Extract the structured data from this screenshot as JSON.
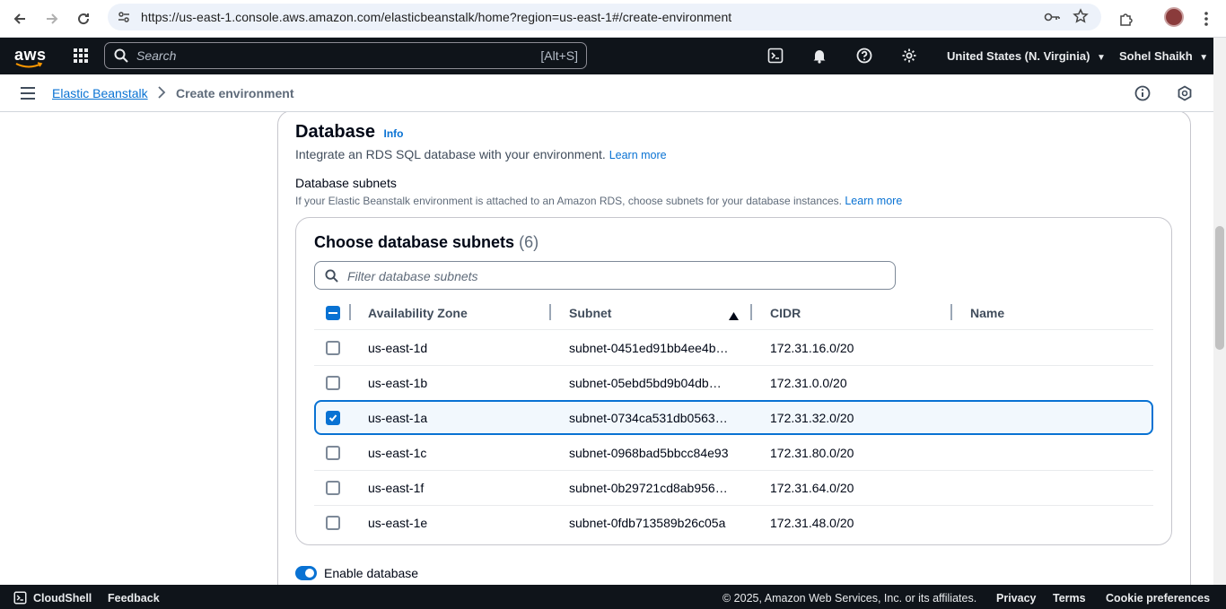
{
  "browser": {
    "url": "https://us-east-1.console.aws.amazon.com/elasticbeanstalk/home?region=us-east-1#/create-environment"
  },
  "topnav": {
    "logo": "aws",
    "search_placeholder": "Search",
    "search_shortcut": "[Alt+S]",
    "region": "United States (N. Virginia)",
    "user": "Sohel Shaikh"
  },
  "breadcrumb": {
    "parent": "Elastic Beanstalk",
    "current": "Create environment"
  },
  "database": {
    "title": "Database",
    "info": "Info",
    "description": "Integrate an RDS SQL database with your environment.",
    "learn_more": "Learn more",
    "subnets_label": "Database subnets",
    "subnets_desc": "If your Elastic Beanstalk environment is attached to an Amazon RDS, choose subnets for your database instances.",
    "subnets_learn_more": "Learn more",
    "table_title": "Choose database subnets",
    "table_count": "(6)",
    "filter_placeholder": "Filter database subnets",
    "columns": [
      "Availability Zone",
      "Subnet",
      "CIDR",
      "Name"
    ],
    "rows": [
      {
        "az": "us-east-1d",
        "subnet": "subnet-0451ed91bb4ee4b…",
        "cidr": "172.31.16.0/20",
        "name": "",
        "selected": false
      },
      {
        "az": "us-east-1b",
        "subnet": "subnet-05ebd5bd9b04db…",
        "cidr": "172.31.0.0/20",
        "name": "",
        "selected": false
      },
      {
        "az": "us-east-1a",
        "subnet": "subnet-0734ca531db0563…",
        "cidr": "172.31.32.0/20",
        "name": "",
        "selected": true
      },
      {
        "az": "us-east-1c",
        "subnet": "subnet-0968bad5bbcc84e93",
        "cidr": "172.31.80.0/20",
        "name": "",
        "selected": false
      },
      {
        "az": "us-east-1f",
        "subnet": "subnet-0b29721cd8ab956…",
        "cidr": "172.31.64.0/20",
        "name": "",
        "selected": false
      },
      {
        "az": "us-east-1e",
        "subnet": "subnet-0fdb713589b26c05a",
        "cidr": "172.31.48.0/20",
        "name": "",
        "selected": false
      }
    ],
    "enable_database_label": "Enable database",
    "enable_database_on": true
  },
  "footer": {
    "cloudshell": "CloudShell",
    "feedback": "Feedback",
    "copyright": "© 2025, Amazon Web Services, Inc. or its affiliates.",
    "privacy": "Privacy",
    "terms": "Terms",
    "cookie": "Cookie preferences"
  },
  "colors": {
    "accent": "#0972d3",
    "nav_bg": "#0f141a"
  }
}
